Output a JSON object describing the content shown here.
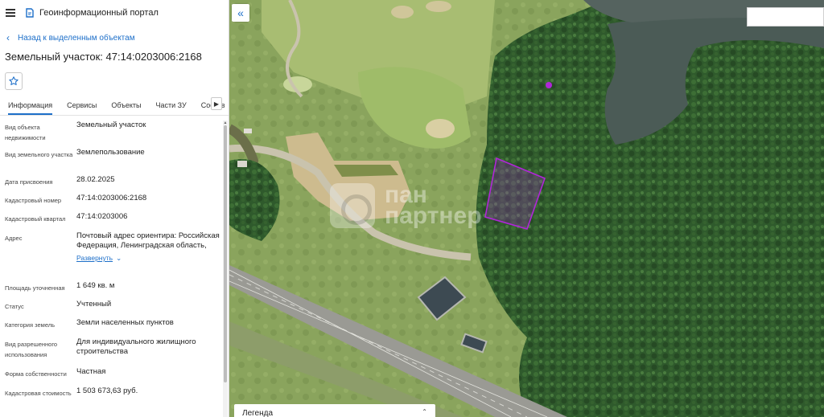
{
  "app": {
    "title": "Геоинформационный портал"
  },
  "nav": {
    "back_label": "Назад к выделенным объектам"
  },
  "object": {
    "title": "Земельный участок: 47:14:0203006:2168"
  },
  "tabs": [
    {
      "label": "Информация",
      "active": true
    },
    {
      "label": "Сервисы"
    },
    {
      "label": "Объекты"
    },
    {
      "label": "Части ЗУ"
    },
    {
      "label": "Состав"
    }
  ],
  "properties": [
    {
      "label": "Вид объекта недвижимости",
      "value": "Земельный участок"
    },
    {
      "label": "Вид земельного участка",
      "value": "Землепользование"
    },
    {
      "label": "Дата присвоения",
      "value": "28.02.2025"
    },
    {
      "label": "Кадастровый номер",
      "value": "47:14:0203006:2168"
    },
    {
      "label": "Кадастровый квартал",
      "value": "47:14:0203006"
    },
    {
      "label": "Адрес",
      "value": "Почтовый адрес ориентира: Российская Федерация, Ленинградская область,",
      "expand": "Развернуть"
    },
    {
      "label": "Площадь уточненная",
      "value": "1 649 кв. м"
    },
    {
      "label": "Статус",
      "value": "Учтенный"
    },
    {
      "label": "Категория земель",
      "value": "Земли населенных пунктов"
    },
    {
      "label": "Вид разрешенного использования",
      "value": "Для индивидуального жилищного строительства"
    },
    {
      "label": "Форма собственности",
      "value": "Частная"
    },
    {
      "label": "Кадастровая стоимость",
      "value": "1 503 673,63 руб."
    }
  ],
  "map": {
    "legend_title": "Легенда",
    "watermark_text_1": "пан",
    "watermark_text_2": "партнер",
    "parcel_color": "#b026d8",
    "accent_color": "#1d6fc9"
  },
  "icons": {
    "menu": "hamburger-icon",
    "logo": "portal-logo-icon",
    "back": "chevron-left-icon",
    "favorite": "star-icon",
    "tabs_next": "chevron-right-icon",
    "collapse": "double-chevron-left-icon",
    "legend_toggle": "chevron-up-down-icon"
  }
}
